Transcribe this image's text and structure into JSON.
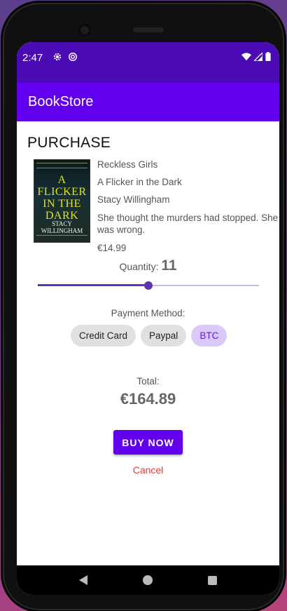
{
  "status": {
    "time": "2:47"
  },
  "app": {
    "title": "BookStore"
  },
  "purchase": {
    "heading": "PURCHASE"
  },
  "book": {
    "series": "Reckless Girls",
    "title": "A Flicker in the Dark",
    "author": "Stacy Willingham",
    "description": "She thought the murders had stopped. She was wrong.",
    "price": "€14.99",
    "cover": {
      "title_text": "A FLICKER IN THE DARK",
      "author_text": "STACY WILLINGHAM",
      "accent_color": "#e4e21b"
    }
  },
  "quantity": {
    "label": "Quantity:",
    "value": "11",
    "slider_fraction": 0.5
  },
  "payment": {
    "label": "Payment Method:",
    "options": [
      "Credit Card",
      "Paypal",
      "BTC"
    ],
    "selected": "BTC"
  },
  "total": {
    "label": "Total:",
    "value": "€164.89"
  },
  "actions": {
    "buy_label": "BUY NOW",
    "cancel_label": "Cancel"
  },
  "colors": {
    "primary": "#6200ee",
    "status_bar": "#4a0ab4",
    "slider": "#5e35b1",
    "cancel": "#e53935"
  },
  "icons": [
    "settings-icon",
    "data-saver-icon",
    "wifi-icon",
    "cellular-signal-icon",
    "battery-icon",
    "back-icon",
    "home-icon",
    "recent-apps-icon"
  ]
}
